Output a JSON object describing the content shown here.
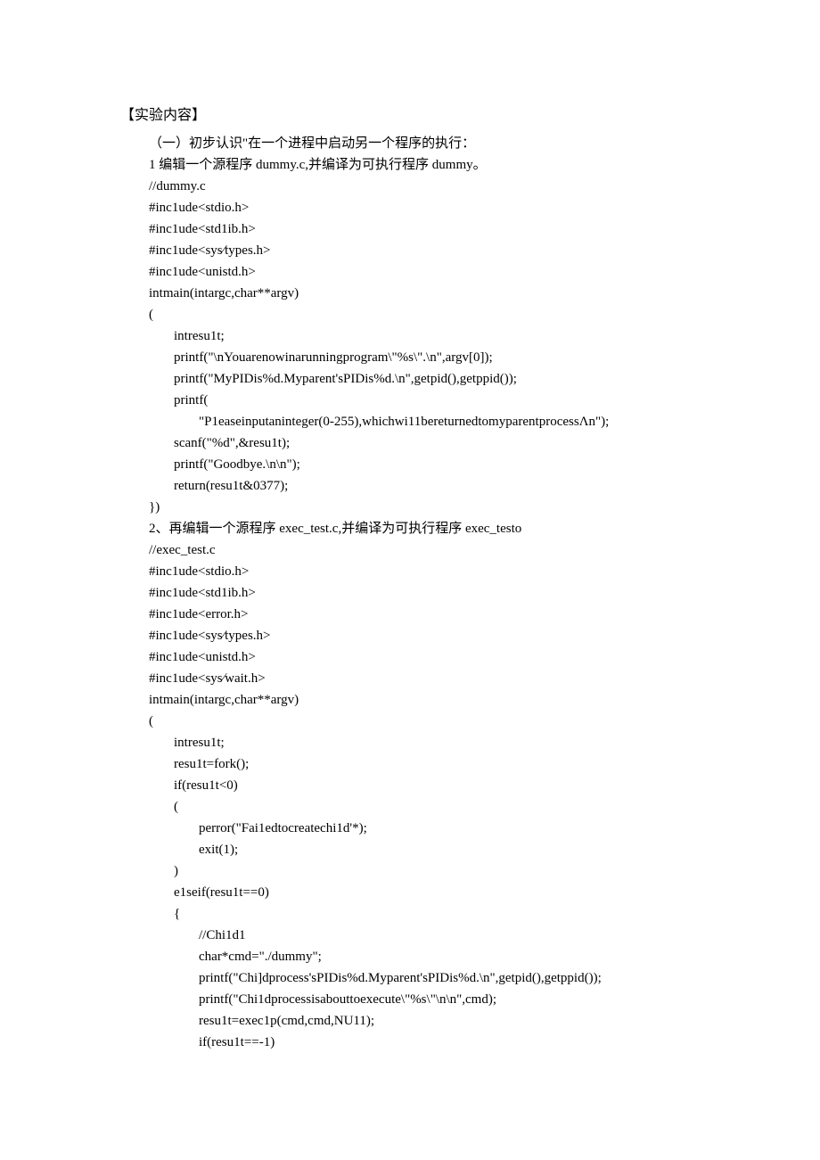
{
  "title": "【实验内容】",
  "lines": [
    "（一）初步认识\"在一个进程中启动另一个程序的执行：",
    "1 编辑一个源程序 dummy.c,并编译为可执行程序 dummy。",
    "//dummy.c",
    "#inc1ude<stdio.h>",
    "#inc1ude<std1ib.h>",
    "#inc1ude<sys∕types.h>",
    "#inc1ude<unistd.h>",
    "intmain(intargc,char**argv)",
    "("
  ],
  "lines_i1": [
    "intresu1t;",
    "printf(\"\\nYouarenowinarunningprogram\\\"%s\\\".\\n\",argv[0]);",
    "printf(\"MyPIDis%d.Myparent'sPIDis%d.\\n\",getpid(),getppid());",
    "printf("
  ],
  "line_deep": "\"P1easeinputaninteger(0-255),whichwi11bereturnedtomyparentprocessΛn\");",
  "lines_i1b": [
    "scanf(\"%d\",&resu1t);",
    "printf(\"Goodbye.\\n\\n\");",
    "return(resu1t&0377);"
  ],
  "close1": "})",
  "lines2": [
    "2、再编辑一个源程序 exec_test.c,并编译为可执行程序 exec_testo",
    "//exec_test.c",
    "#inc1ude<stdio.h>",
    "#inc1ude<std1ib.h>",
    "#inc1ude<error.h>",
    "#inc1ude<sys∕types.h>",
    "#inc1ude<unistd.h>",
    "#inc1ude<sys∕wait.h>",
    "intmain(intargc,char**argv)",
    "("
  ],
  "lines2_i1": [
    "intresu1t;",
    "resu1t=fork();",
    "if(resu1t<0)",
    "("
  ],
  "lines2_i2a": [
    "perror(\"Fai1edtocreatechi1d'*);",
    "exit(1);"
  ],
  "lines2_close_if": ")",
  "lines2_elseif": [
    "e1seif(resu1t==0)",
    "{"
  ],
  "lines2_i2b": [
    "//Chi1d1",
    "char*cmd=\"./dummy\";",
    "printf(\"Chi]dprocess'sPIDis%d.Myparent'sPIDis%d.\\n\",getpid(),getppid());",
    "printf(\"Chi1dprocessisabouttoexecute\\\"%s\\\"\\n\\n\",cmd);",
    "resu1t=exec1p(cmd,cmd,NU11);",
    "if(resu1t==-1)"
  ]
}
